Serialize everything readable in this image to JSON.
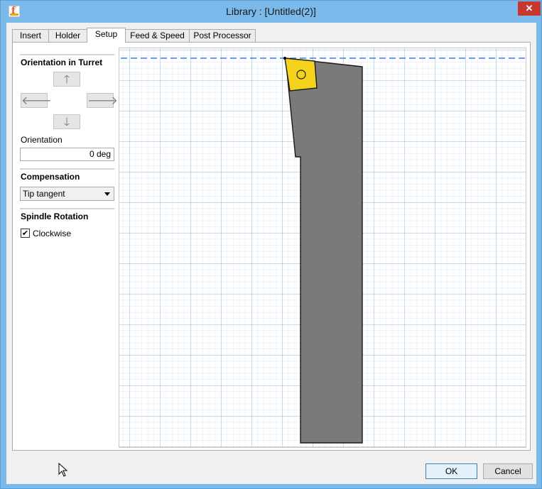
{
  "window": {
    "title": "Library :  [Untitled(2)]",
    "close_label": "✕",
    "accent": "#7ab9e9"
  },
  "tabs": [
    {
      "label": "Insert"
    },
    {
      "label": "Holder"
    },
    {
      "label": "Setup"
    },
    {
      "label": "Feed & Speed"
    },
    {
      "label": "Post Processor"
    }
  ],
  "active_tab": "Setup",
  "orientation_in_turret": {
    "heading": "Orientation in Turret",
    "up_icon": "arrow-up-icon",
    "left_icon": "arrow-left-icon",
    "right_icon": "arrow-right-icon",
    "down_icon": "arrow-down-icon"
  },
  "orientation": {
    "label": "Orientation",
    "value": "0 deg"
  },
  "compensation": {
    "heading": "Compensation",
    "selected": "Tip tangent"
  },
  "spindle_rotation": {
    "heading": "Spindle Rotation",
    "checkbox_label": "Clockwise",
    "checked": true
  },
  "preview": {
    "grid_color": "#bcd5ec",
    "grid_major_color": "#8fb3d6",
    "axis_dash_color": "#3a7fd8",
    "holder_color": "#7a7a7a",
    "insert_color": "#f5d21c"
  },
  "footer": {
    "ok_label": "OK",
    "cancel_label": "Cancel"
  }
}
